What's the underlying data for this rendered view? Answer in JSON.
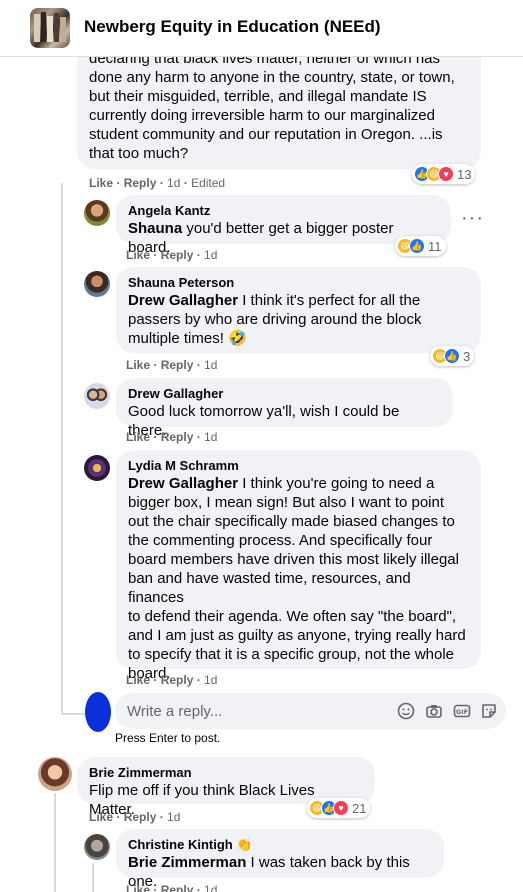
{
  "header": {
    "title": "Newberg Equity in Education (NEEd)"
  },
  "comments": [
    {
      "id": "top",
      "body": "declaring that black lives matter, neither of which has\ndone any harm to anyone in the country, state, or town,\nbut their misguided, terrible, and illegal mandate IS\ncurrently doing irreversible harm to our marginalized\nstudent community and our reputation in Oregon. ...is\nthat too much?",
      "actions": {
        "like": "Like",
        "reply": "Reply",
        "time": "1d",
        "edited": "Edited"
      },
      "reaction_count": "13"
    },
    {
      "id": "angela",
      "author": "Angela Kantz",
      "mention": "Shauna",
      "text": " you'd better get a bigger poster board.",
      "actions": {
        "like": "Like",
        "reply": "Reply",
        "time": "1d"
      },
      "reaction_count": "11"
    },
    {
      "id": "shauna",
      "author": "Shauna Peterson",
      "mention": "Drew Gallagher",
      "text": " I think it's perfect for all the\npassers by who are driving around the block\nmultiple times! 🤣",
      "actions": {
        "like": "Like",
        "reply": "Reply",
        "time": "1d"
      },
      "reaction_count": "3"
    },
    {
      "id": "drew",
      "author": "Drew Gallagher",
      "text": "Good luck tomorrow ya'll, wish I could be there.",
      "actions": {
        "like": "Like",
        "reply": "Reply",
        "time": "1d"
      }
    },
    {
      "id": "lydia",
      "author": "Lydia M Schramm",
      "mention": "Drew Gallagher",
      "text": " I think you're going to need a\nbigger box, I mean sign! But also I want to point\nout the chair specifically made biased changes to\nthe commenting process. And specifically four\nboard members have driven this most likely illegal\nban and have wasted time, resources, and finances\nto defend their agenda. We often say \"the board\",\nand I am just as guilty as anyone, trying really hard\nto specify that it is a specific group, not the whole\nboard.",
      "actions": {
        "like": "Like",
        "reply": "Reply",
        "time": "1d"
      }
    },
    {
      "id": "brie",
      "author": "Brie Zimmerman",
      "text": "Flip me off if you think Black Lives Matter.",
      "actions": {
        "like": "Like",
        "reply": "Reply",
        "time": "1d"
      },
      "reaction_count": "21"
    },
    {
      "id": "christine",
      "author": "Christine Kintigh",
      "mention": "Brie Zimmerman",
      "text": " I was taken back by this one.",
      "actions": {
        "like": "Like",
        "reply": "Reply",
        "time": "1d"
      }
    }
  ],
  "reply_box": {
    "placeholder": "Write a reply...",
    "hint": "Press Enter to post."
  },
  "colors": {
    "bubble": "#f0f2f5",
    "like": "#1877f2",
    "haha": "#f7b928",
    "love": "#f33e58",
    "meta": "#65676b"
  },
  "icons": [
    "like-reaction-icon",
    "haha-reaction-icon",
    "love-reaction-icon",
    "more-options-icon",
    "emoji-icon",
    "camera-icon",
    "gif-icon",
    "sticker-icon",
    "clap-hand-icon"
  ]
}
